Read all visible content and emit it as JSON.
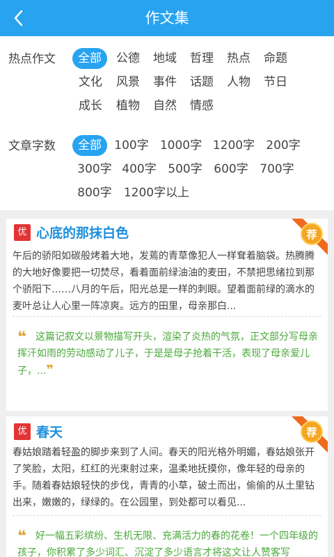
{
  "header": {
    "title": "作文集",
    "back_icon": "chevron-left-icon",
    "bg_color": "#27a3f0"
  },
  "filters": {
    "topic": {
      "label": "热点作文",
      "selected": "全部",
      "options": [
        "全部",
        "公德",
        "地域",
        "哲理",
        "热点",
        "命题",
        "文化",
        "风景",
        "事件",
        "话题",
        "人物",
        "节日",
        "成长",
        "植物",
        "自然",
        "情感"
      ]
    },
    "word_count": {
      "label": "文章字数",
      "selected": "全部",
      "options": [
        "全部",
        "100字",
        "1000字",
        "1200字",
        "200字",
        "300字",
        "400字",
        "500字",
        "600字",
        "700字",
        "800字",
        "1200字以上"
      ]
    }
  },
  "articles": [
    {
      "badge": "优",
      "title": "心底的那抹白色",
      "ribbon_text": "荐",
      "excerpt": "午后的骄阳如碳般烤着大地，发蔫的青草像犯人一样耷着脑袋。热腾腾的大地好像要把一切焚尽，看着面前绿油油的麦田，不禁把思绪拉到那个骄阳下……八月的午后，阳光总是一样的刺眼。望着面前绿的滴水的麦叶总让人心里一阵凉爽。远方的田里，母亲那白...",
      "comment": "这篇记叙文以景物描写开头，渲染了炎热的气氛，正文部分写母亲挥汗如雨的劳动感动了儿子，于是是母子抢着干活，表现了母亲爱儿子，...",
      "quote_open": "❝",
      "quote_close": "❞"
    },
    {
      "badge": "优",
      "title": "春天",
      "ribbon_text": "荐",
      "excerpt": "春姑娘踏着轻盈的脚步来到了人间。春天的阳光格外明媚，春姑娘张开了笑脸，太阳，红红的光束射过来，温柔地抚摸你，像年轻的母亲的手。随着春姑娘轻快的步伐，青青的小草，破土而出，偷偷的从土里钻出来，嫩嫩的，绿绿的。在公园里，到处都可以看见...",
      "comment": "好一幅五彩缤纷、生机无限、充满活力的春的花卷！一个四年级的孩子，你积累了多少词汇、沉淀了多少语言才将这文让人赞客写",
      "quote_open": "❝",
      "quote_close": "❞"
    }
  ]
}
